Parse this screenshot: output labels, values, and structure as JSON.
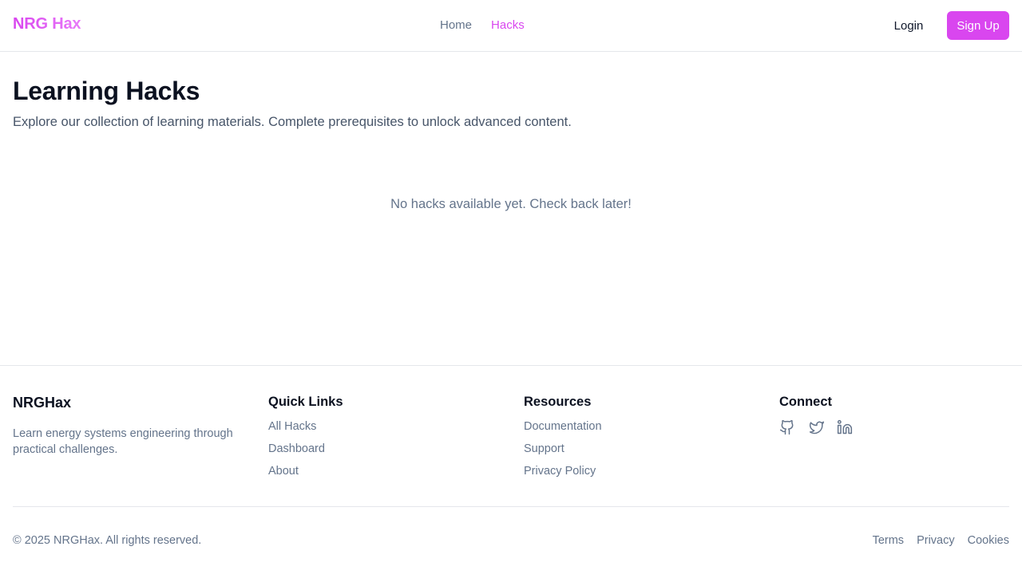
{
  "header": {
    "brand": "NRG Hax",
    "nav": [
      {
        "label": "Home",
        "active": false
      },
      {
        "label": "Hacks",
        "active": true
      }
    ],
    "login_label": "Login",
    "signup_label": "Sign Up"
  },
  "main": {
    "title": "Learning Hacks",
    "subtitle": "Explore our collection of learning materials. Complete prerequisites to unlock advanced content.",
    "empty_message": "No hacks available yet. Check back later!"
  },
  "footer": {
    "brand": "NRGHax",
    "description": "Learn energy systems engineering through practical challenges.",
    "quick_links": {
      "heading": "Quick Links",
      "items": [
        "All Hacks",
        "Dashboard",
        "About"
      ]
    },
    "resources": {
      "heading": "Resources",
      "items": [
        "Documentation",
        "Support",
        "Privacy Policy"
      ]
    },
    "connect": {
      "heading": "Connect",
      "icons": [
        "github-icon",
        "twitter-icon",
        "linkedin-icon"
      ]
    },
    "copyright": "© 2025 NRGHax. All rights reserved.",
    "legal": [
      "Terms",
      "Privacy",
      "Cookies"
    ]
  },
  "colors": {
    "accent": "#d946ef",
    "muted_text": "#64748b",
    "heading_text": "#0b1120",
    "border": "#e5e7eb"
  }
}
